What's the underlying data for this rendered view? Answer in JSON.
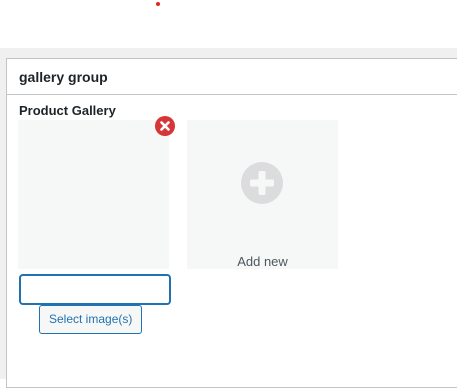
{
  "metabox": {
    "title": "gallery group"
  },
  "field": {
    "label": "Product Gallery",
    "input_value": ""
  },
  "gallery": {
    "add_new_label": "Add new",
    "remove_icon": "remove-circle-icon",
    "plus_icon": "plus-circle-icon"
  },
  "actions": {
    "select_images_label": "Select image(s)"
  },
  "colors": {
    "accent": "#2271b1",
    "remove_red": "#d63638",
    "thumb_bg": "#f6f7f7",
    "plus_gray": "#dcdcde"
  }
}
